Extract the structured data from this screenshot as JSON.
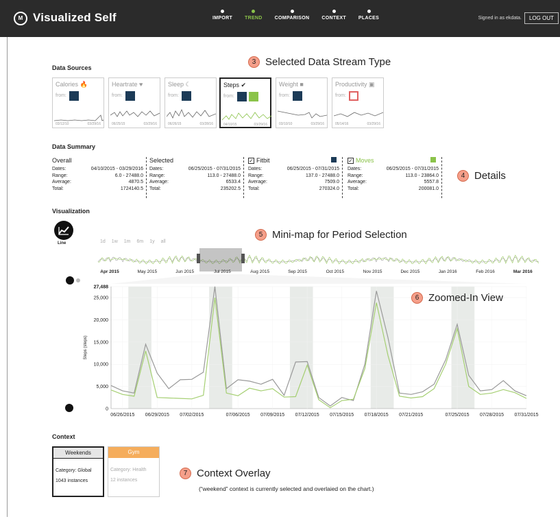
{
  "header": {
    "app_title": "Visualized Self",
    "logo_text": "M",
    "nav": [
      "IMPORT",
      "TREND",
      "COMPARISON",
      "CONTEXT",
      "PLACES"
    ],
    "active_nav": "TREND",
    "signed_in": "Signed in as ekdata.",
    "logout": "LOG OUT"
  },
  "callouts": {
    "c3": {
      "num": "3",
      "text": "Selected Data Stream Type"
    },
    "c4": {
      "num": "4",
      "text": "Details"
    },
    "c5": {
      "num": "5",
      "text": "Mini-map for Period Selection"
    },
    "c6": {
      "num": "6",
      "text": "Zoomed-In View"
    },
    "c7": {
      "num": "7",
      "text": "Context Overlay",
      "note": "(“weekend” context is currently selected and overlaied on the chart.)"
    }
  },
  "data_sources": {
    "title": "Data Sources",
    "from_label": "from:",
    "cards": [
      {
        "name": "Calories",
        "icon": "🔥",
        "start": "03/12/10",
        "end": "03/29/16",
        "selected": false
      },
      {
        "name": "Heartrate",
        "icon": "♥",
        "start": "06/25/15",
        "end": "03/29/16",
        "selected": false
      },
      {
        "name": "Sleep",
        "icon": "☾",
        "start": "06/26/15",
        "end": "03/28/16",
        "selected": false
      },
      {
        "name": "Steps",
        "icon": "✔",
        "start": "04/10/15",
        "end": "03/29/16",
        "selected": true
      },
      {
        "name": "Weight",
        "icon": "■",
        "start": "03/10/10",
        "end": "03/29/16",
        "selected": false
      },
      {
        "name": "Productivity",
        "icon": "▣",
        "start": "05/14/16",
        "end": "03/29/16",
        "selected": false
      }
    ]
  },
  "data_summary": {
    "title": "Data Summary",
    "labels": {
      "dates": "Dates:",
      "range": "Range:",
      "average": "Average:",
      "total": "Total:"
    },
    "boxes": [
      {
        "title": "Overall",
        "dates": "04/10/2015 - 03/29/2016",
        "range": "6.0 - 27488.0",
        "average": "4870.5",
        "total": "1724140.5"
      },
      {
        "title": "Selected",
        "dates": "06/25/2015 - 07/31/2015",
        "range": "113.0 - 27488.0",
        "average": "6533.4",
        "total": "235202.5"
      },
      {
        "title": "Fitbit",
        "dates": "06/25/2015 - 07/31/2015",
        "range": "137.0 - 27488.0",
        "average": "7509.0",
        "total": "270324.0",
        "checked": true
      },
      {
        "title": "Moves",
        "dates": "06/25/2015 - 07/31/2015",
        "range": "113.0 - 23864.0",
        "average": "5557.8",
        "total": "200081.0",
        "checked": true
      }
    ]
  },
  "visualization": {
    "title": "Visualization",
    "chart_type_label": "Line",
    "ranges": [
      "1d",
      "1w",
      "1m",
      "6m",
      "1y",
      "all"
    ],
    "minimap": {
      "months": [
        "Apr 2015",
        "May 2015",
        "Jun 2015",
        "Jul 2015",
        "Aug 2015",
        "Sep 2015",
        "Oct 2015",
        "Nov 2015",
        "Dec 2015",
        "Jan 2016",
        "Feb 2016",
        "Mar 2016"
      ]
    }
  },
  "chart_data": {
    "type": "line",
    "ylabel": "Steps (steps)",
    "ylim": [
      0,
      27488
    ],
    "yticks": [
      0,
      5000,
      10000,
      15000,
      20000,
      25000,
      27488
    ],
    "ytick_labels": [
      "0",
      "5,000",
      "10,000",
      "15,000",
      "20,000",
      "25,000",
      "27,488"
    ],
    "x": [
      "06/25/2015",
      "06/26/2015",
      "06/27/2015",
      "06/28/2015",
      "06/29/2015",
      "06/30/2015",
      "07/01/2015",
      "07/02/2015",
      "07/03/2015",
      "07/04/2015",
      "07/05/2015",
      "07/06/2015",
      "07/07/2015",
      "07/08/2015",
      "07/09/2015",
      "07/10/2015",
      "07/11/2015",
      "07/12/2015",
      "07/13/2015",
      "07/14/2015",
      "07/15/2015",
      "07/16/2015",
      "07/17/2015",
      "07/18/2015",
      "07/19/2015",
      "07/20/2015",
      "07/21/2015",
      "07/22/2015",
      "07/23/2015",
      "07/24/2015",
      "07/25/2015",
      "07/26/2015",
      "07/27/2015",
      "07/28/2015",
      "07/29/2015",
      "07/30/2015",
      "07/31/2015"
    ],
    "x_tick_labels": [
      "06/26/2015",
      "06/29/2015",
      "07/02/2015",
      "07/06/2015",
      "07/09/2015",
      "07/12/2015",
      "07/15/2015",
      "07/18/2015",
      "07/21/2015",
      "07/25/2015",
      "07/28/2015",
      "07/31/2015"
    ],
    "series": [
      {
        "name": "Fitbit",
        "color": "#999999",
        "values": [
          5200,
          4000,
          3500,
          14500,
          8000,
          4500,
          6500,
          6600,
          8200,
          27488,
          4500,
          6500,
          6200,
          5500,
          6600,
          3000,
          10500,
          10600,
          2500,
          600,
          2500,
          1800,
          10000,
          26500,
          16000,
          3500,
          3200,
          3800,
          5500,
          11000,
          19000,
          7500,
          4000,
          4300,
          6300,
          4000,
          2900
        ]
      },
      {
        "name": "Moves",
        "color": "#a5cf72",
        "values": [
          4200,
          3200,
          2800,
          13000,
          2500,
          2400,
          2300,
          2200,
          3000,
          25000,
          3500,
          2900,
          4600,
          4000,
          4500,
          2600,
          2700,
          9800,
          2000,
          200,
          1800,
          2100,
          9000,
          23864,
          12000,
          2800,
          2400,
          2700,
          4500,
          10000,
          18000,
          5000,
          3200,
          3500,
          4300,
          3600,
          2300
        ]
      }
    ],
    "context_bands": [
      [
        "06/27/2015",
        "06/28/2015"
      ],
      [
        "07/04/2015",
        "07/05/2015"
      ],
      [
        "07/11/2015",
        "07/12/2015"
      ],
      [
        "07/18/2015",
        "07/19/2015"
      ],
      [
        "07/25/2015",
        "07/26/2015"
      ]
    ]
  },
  "context": {
    "title": "Context",
    "cards": [
      {
        "name": "Weekends",
        "category": "Category: Global",
        "instances": "1043 instances",
        "color": "#ffffff",
        "selected": true
      },
      {
        "name": "Gym",
        "category": "Category: Health",
        "instances": "12 instances",
        "color": "#f5ad5c",
        "selected": false
      }
    ]
  },
  "colors": {
    "accent": "#8bc34a",
    "topbar": "#2b2b2b",
    "callout": "#f59f8a"
  }
}
